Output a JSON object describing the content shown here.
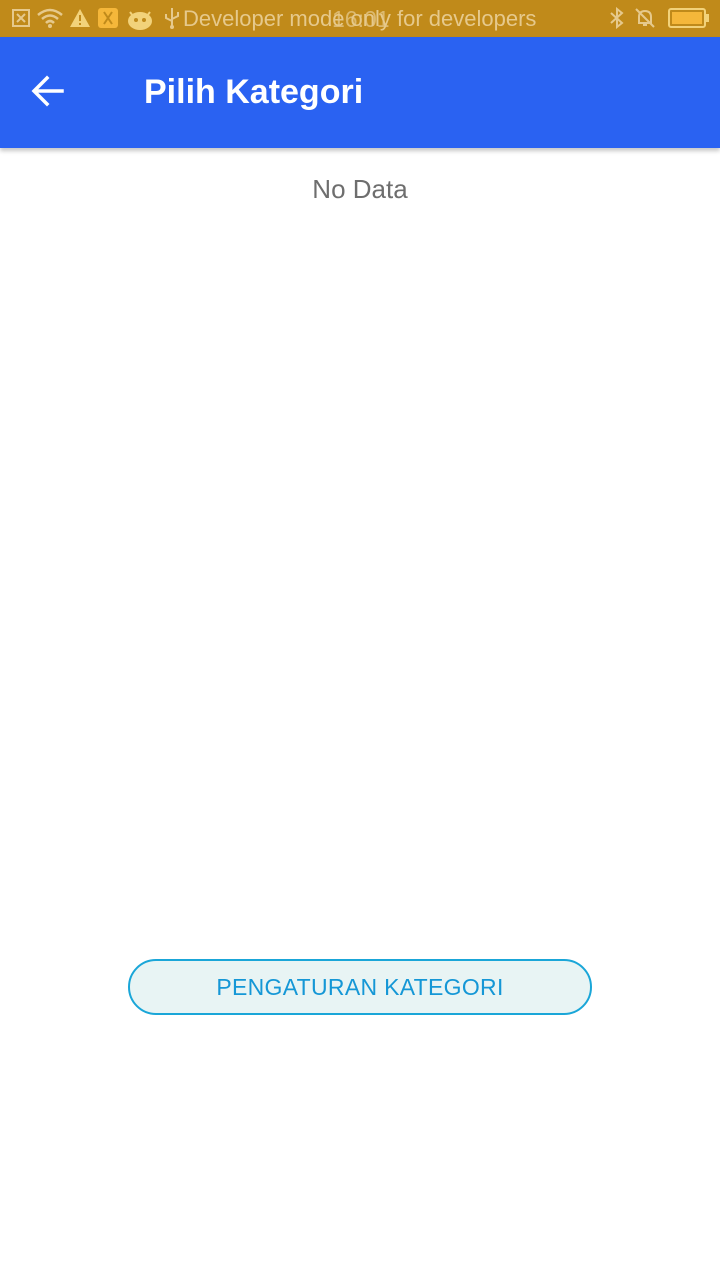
{
  "status_bar": {
    "notification_text": "Developer mode only for developers",
    "time": "16:01",
    "icons": [
      "close-box-icon",
      "wifi-icon",
      "warning-icon",
      "app-notification-icon",
      "android-icon",
      "usb-icon",
      "bluetooth-icon",
      "muted-bell-icon",
      "battery-icon"
    ]
  },
  "app_bar": {
    "back_icon": "arrow-left-icon",
    "title": "Pilih Kategori"
  },
  "content": {
    "empty_message": "No Data"
  },
  "actions": {
    "settings_button_label": "PENGATURAN KATEGORI"
  },
  "colors": {
    "status_bar": "#c08a1a",
    "app_bar": "#2a62f2",
    "accent": "#1597d6"
  }
}
